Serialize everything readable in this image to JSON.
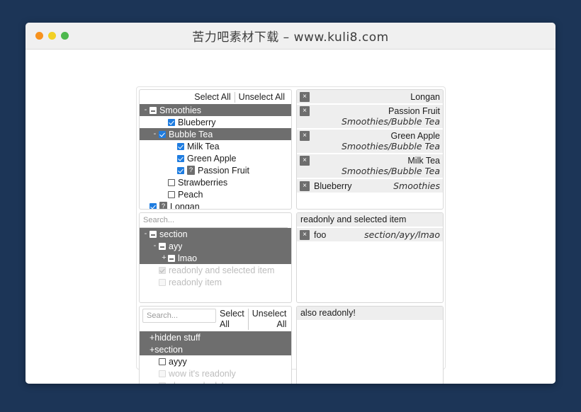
{
  "window": {
    "title": "苦力吧素材下载 – www.kuli8.com",
    "lights": [
      "close-orange",
      "minimize-yellow",
      "maximize-green"
    ]
  },
  "section1": {
    "toolbar": {
      "select_all": "Select All",
      "unselect_all": "Unselect All"
    },
    "tree": [
      {
        "label": "Smoothies",
        "indent": 0,
        "twisty": "-",
        "state": "partial",
        "selected": true,
        "badge": null
      },
      {
        "label": "Blueberry",
        "indent": 2,
        "twisty": "",
        "state": "checked",
        "selected": false,
        "badge": null
      },
      {
        "label": "Bubble Tea",
        "indent": 1,
        "twisty": "-",
        "state": "checked",
        "selected": true,
        "badge": null
      },
      {
        "label": "Milk Tea",
        "indent": 3,
        "twisty": "",
        "state": "checked",
        "selected": false,
        "badge": null
      },
      {
        "label": "Green Apple",
        "indent": 3,
        "twisty": "",
        "state": "checked",
        "selected": false,
        "badge": null
      },
      {
        "label": "Passion Fruit",
        "indent": 3,
        "twisty": "",
        "state": "checked",
        "selected": false,
        "badge": "?"
      },
      {
        "label": "Strawberries",
        "indent": 2,
        "twisty": "",
        "state": "unchecked",
        "selected": false,
        "badge": null
      },
      {
        "label": "Peach",
        "indent": 2,
        "twisty": "",
        "state": "unchecked",
        "selected": false,
        "badge": null
      },
      {
        "label": "Longan",
        "indent": 0,
        "twisty": "",
        "state": "checked",
        "selected": false,
        "badge": "?"
      }
    ],
    "selected_items": [
      {
        "name": "Longan",
        "path": "",
        "remove": "×"
      },
      {
        "name": "Passion Fruit",
        "path": "Smoothies/Bubble Tea",
        "remove": "×"
      },
      {
        "name": "Green Apple",
        "path": "Smoothies/Bubble Tea",
        "remove": "×"
      },
      {
        "name": "Milk Tea",
        "path": "Smoothies/Bubble Tea",
        "remove": "×"
      },
      {
        "name": "Blueberry",
        "path": "Smoothies",
        "remove": "×"
      }
    ]
  },
  "section2": {
    "search_placeholder": "Search...",
    "search_value": "",
    "tree": [
      {
        "label": "section",
        "indent": 0,
        "twisty": "-",
        "state": "partial",
        "selected": true,
        "readonly": false
      },
      {
        "label": "ayy",
        "indent": 1,
        "twisty": "-",
        "state": "partial",
        "selected": true,
        "readonly": false
      },
      {
        "label": "lmao",
        "indent": 2,
        "twisty": "+",
        "state": "partial",
        "selected": true,
        "readonly": false
      },
      {
        "label": "readonly and selected item",
        "indent": 1,
        "twisty": "",
        "state": "checked",
        "selected": false,
        "readonly": true
      },
      {
        "label": "readonly item",
        "indent": 1,
        "twisty": "",
        "state": "unchecked",
        "selected": false,
        "readonly": true
      }
    ],
    "selected_items": [
      {
        "name": "readonly and selected item",
        "path": "",
        "remove": "",
        "plain": true
      },
      {
        "name": "foo",
        "path": "section/ayy/lmao",
        "remove": "×",
        "plain": false
      }
    ]
  },
  "section3": {
    "search_placeholder": "Search...",
    "search_value": "",
    "toolbar": {
      "select_all": "Select All",
      "unselect_all": "Unselect All"
    },
    "tree": [
      {
        "label": "+hidden stuff",
        "indent": 0,
        "twisty": "",
        "state": "none",
        "selected": true,
        "readonly": false
      },
      {
        "label": "+section",
        "indent": 0,
        "twisty": "",
        "state": "none",
        "selected": true,
        "readonly": false
      },
      {
        "label": "ayyy",
        "indent": 1,
        "twisty": "",
        "state": "unchecked",
        "selected": false,
        "readonly": false
      },
      {
        "label": "wow it's readonly",
        "indent": 1,
        "twisty": "",
        "state": "unchecked",
        "selected": false,
        "readonly": true
      },
      {
        "label": "also readonly!",
        "indent": 1,
        "twisty": "",
        "state": "checked",
        "selected": false,
        "readonly": true
      }
    ],
    "selected_items": [
      {
        "name": "also readonly!",
        "path": "",
        "remove": "",
        "plain": true
      }
    ]
  },
  "colors": {
    "desktop": "#1c3557",
    "selected_row": "#6e6e6e",
    "checkbox_blue": "#1e7ce0",
    "chip_bg": "#eeeeee",
    "titlebar": "#f0f0f0"
  }
}
